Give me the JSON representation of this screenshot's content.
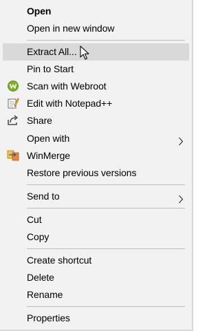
{
  "menu": {
    "items": [
      {
        "label": "Open"
      },
      {
        "label": "Open in new window"
      },
      {
        "label": "Extract All..."
      },
      {
        "label": "Pin to Start"
      },
      {
        "label": "Scan with Webroot",
        "icon": "webroot-icon"
      },
      {
        "label": "Edit with Notepad++",
        "icon": "notepad-plus-plus-icon"
      },
      {
        "label": "Share",
        "icon": "share-icon"
      },
      {
        "label": "Open with",
        "icon": "chevron-right-icon"
      },
      {
        "label": "WinMerge",
        "icon": "winmerge-icon"
      },
      {
        "label": "Restore previous versions"
      },
      {
        "label": "Send to",
        "icon": "chevron-right-icon"
      },
      {
        "label": "Cut"
      },
      {
        "label": "Copy"
      },
      {
        "label": "Create shortcut"
      },
      {
        "label": "Delete"
      },
      {
        "label": "Rename"
      },
      {
        "label": "Properties"
      }
    ],
    "hovered_item": "Extract All...",
    "colors": {
      "background": "#f2f2f2",
      "hover": "#d9d9d9",
      "separator": "#bdbdbd",
      "text": "#000000",
      "webroot_green": "#6a9a1f"
    }
  }
}
